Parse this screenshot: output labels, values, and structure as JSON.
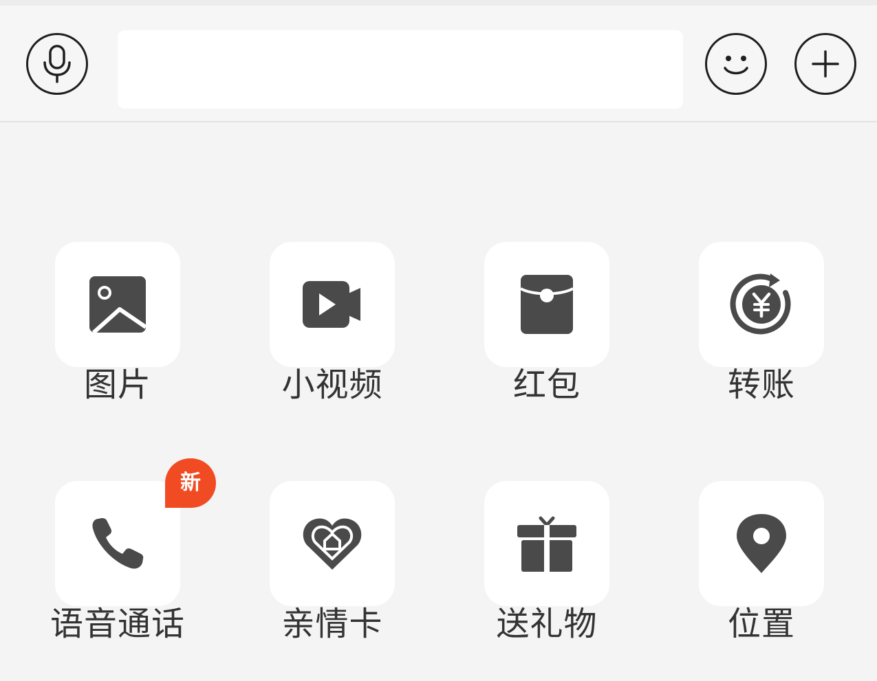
{
  "composer": {
    "input_value": "",
    "input_placeholder": ""
  },
  "icons": {
    "voice": "microphone-icon",
    "emoji": "smiley-icon",
    "more": "plus-icon",
    "icon_color": "#4a4a4a",
    "border_color": "#1f1f1f"
  },
  "panel": {
    "items": [
      {
        "label": "图片",
        "icon": "image-icon"
      },
      {
        "label": "小视频",
        "icon": "video-camera-icon"
      },
      {
        "label": "红包",
        "icon": "red-envelope-icon"
      },
      {
        "label": "转账",
        "icon": "yuan-transfer-icon"
      },
      {
        "label": "语音通话",
        "icon": "phone-icon",
        "badge": "新"
      },
      {
        "label": "亲情卡",
        "icon": "heart-home-icon"
      },
      {
        "label": "送礼物",
        "icon": "gift-icon"
      },
      {
        "label": "位置",
        "icon": "location-pin-icon"
      }
    ],
    "badge_color": "#f04b22"
  }
}
